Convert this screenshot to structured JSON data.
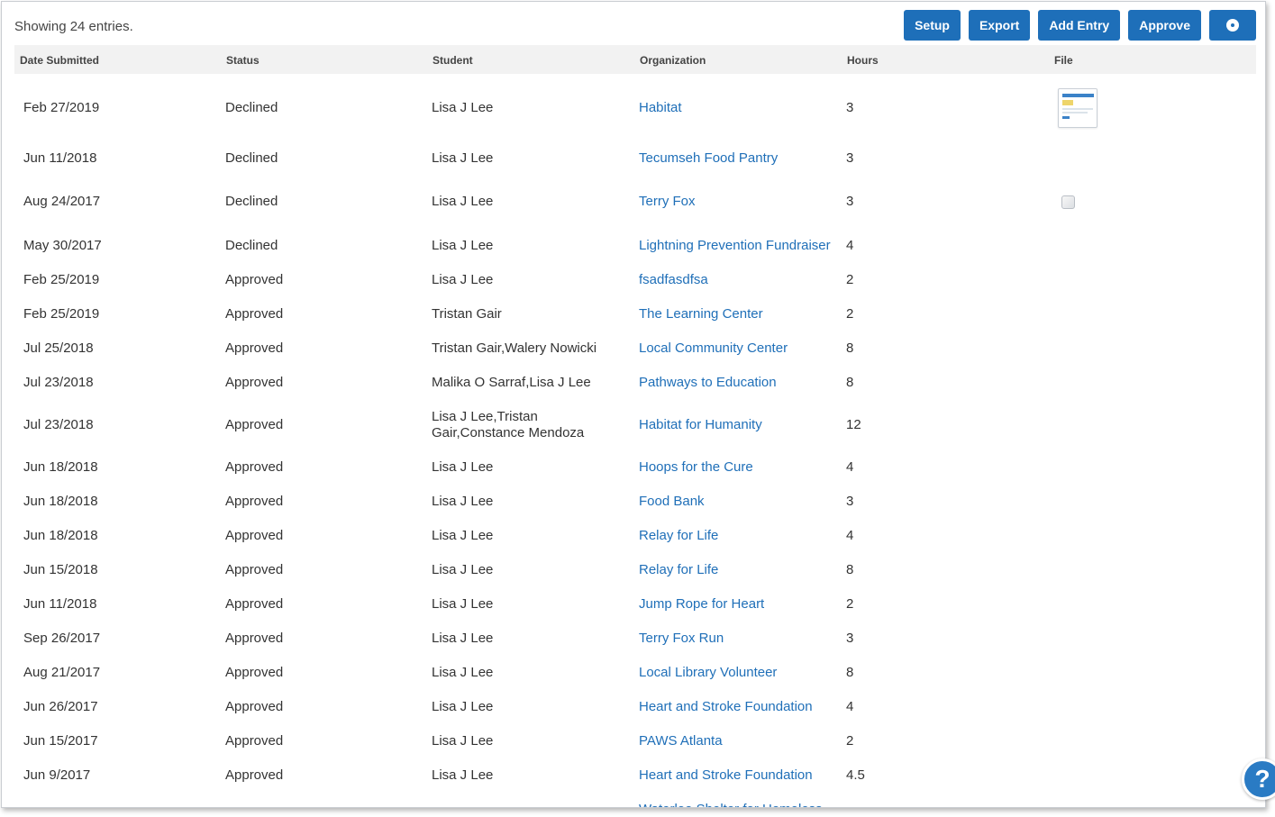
{
  "summary": "Showing 24 entries.",
  "toolbar": {
    "setup_label": "Setup",
    "export_label": "Export",
    "add_entry_label": "Add Entry",
    "approve_label": "Approve",
    "settings_icon": "gear-icon"
  },
  "columns": {
    "date": "Date Submitted",
    "status": "Status",
    "student": "Student",
    "organization": "Organization",
    "hours": "Hours",
    "file": "File"
  },
  "rows": [
    {
      "date": "Feb 27/2019",
      "status": "Declined",
      "student": "Lisa J Lee",
      "organization": "Habitat",
      "hours": "3",
      "file": "thumbnail"
    },
    {
      "date": "Jun 11/2018",
      "status": "Declined",
      "student": "Lisa J Lee",
      "organization": "Tecumseh Food Pantry",
      "hours": "3",
      "file": ""
    },
    {
      "date": "Aug 24/2017",
      "status": "Declined",
      "student": "Lisa J Lee",
      "organization": "Terry Fox",
      "hours": "3",
      "file": "broken-image"
    },
    {
      "date": "May 30/2017",
      "status": "Declined",
      "student": "Lisa J Lee",
      "organization": "Lightning Prevention Fundraiser",
      "hours": "4",
      "file": ""
    },
    {
      "date": "Feb 25/2019",
      "status": "Approved",
      "student": "Lisa J Lee",
      "organization": "fsadfasdfsa",
      "hours": "2",
      "file": ""
    },
    {
      "date": "Feb 25/2019",
      "status": "Approved",
      "student": "Tristan Gair",
      "organization": "The Learning Center",
      "hours": "2",
      "file": ""
    },
    {
      "date": "Jul 25/2018",
      "status": "Approved",
      "student": "Tristan Gair,Walery Nowicki",
      "organization": "Local Community Center",
      "hours": "8",
      "file": ""
    },
    {
      "date": "Jul 23/2018",
      "status": "Approved",
      "student": "Malika O Sarraf,Lisa J Lee",
      "organization": "Pathways to Education",
      "hours": "8",
      "file": ""
    },
    {
      "date": "Jul 23/2018",
      "status": "Approved",
      "student": "Lisa J Lee,Tristan Gair,Constance Mendoza",
      "organization": "Habitat for Humanity",
      "hours": "12",
      "file": ""
    },
    {
      "date": "Jun 18/2018",
      "status": "Approved",
      "student": "Lisa J Lee",
      "organization": "Hoops for the Cure",
      "hours": "4",
      "file": ""
    },
    {
      "date": "Jun 18/2018",
      "status": "Approved",
      "student": "Lisa J Lee",
      "organization": "Food Bank",
      "hours": "3",
      "file": ""
    },
    {
      "date": "Jun 18/2018",
      "status": "Approved",
      "student": "Lisa J Lee",
      "organization": "Relay for Life",
      "hours": "4",
      "file": ""
    },
    {
      "date": "Jun 15/2018",
      "status": "Approved",
      "student": "Lisa J Lee",
      "organization": "Relay for Life",
      "hours": "8",
      "file": ""
    },
    {
      "date": "Jun 11/2018",
      "status": "Approved",
      "student": "Lisa J Lee",
      "organization": "Jump Rope for Heart",
      "hours": "2",
      "file": ""
    },
    {
      "date": "Sep 26/2017",
      "status": "Approved",
      "student": "Lisa J Lee",
      "organization": "Terry Fox Run",
      "hours": "3",
      "file": ""
    },
    {
      "date": "Aug 21/2017",
      "status": "Approved",
      "student": "Lisa J Lee",
      "organization": "Local Library Volunteer",
      "hours": "8",
      "file": ""
    },
    {
      "date": "Jun 26/2017",
      "status": "Approved",
      "student": "Lisa J Lee",
      "organization": "Heart and Stroke Foundation",
      "hours": "4",
      "file": ""
    },
    {
      "date": "Jun 15/2017",
      "status": "Approved",
      "student": "Lisa J Lee",
      "organization": "PAWS Atlanta",
      "hours": "2",
      "file": ""
    },
    {
      "date": "Jun 9/2017",
      "status": "Approved",
      "student": "Lisa J Lee",
      "organization": "Heart and Stroke Foundation",
      "hours": "4.5",
      "file": ""
    },
    {
      "date": "",
      "status": "",
      "student": "",
      "organization": "Waterloo Shelter for Homeless",
      "hours": "",
      "file": ""
    }
  ],
  "help": {
    "label": "?"
  },
  "colors": {
    "button": "#1e6fb9",
    "link": "#1f6fb8",
    "header_bg": "#f2f2f2"
  }
}
